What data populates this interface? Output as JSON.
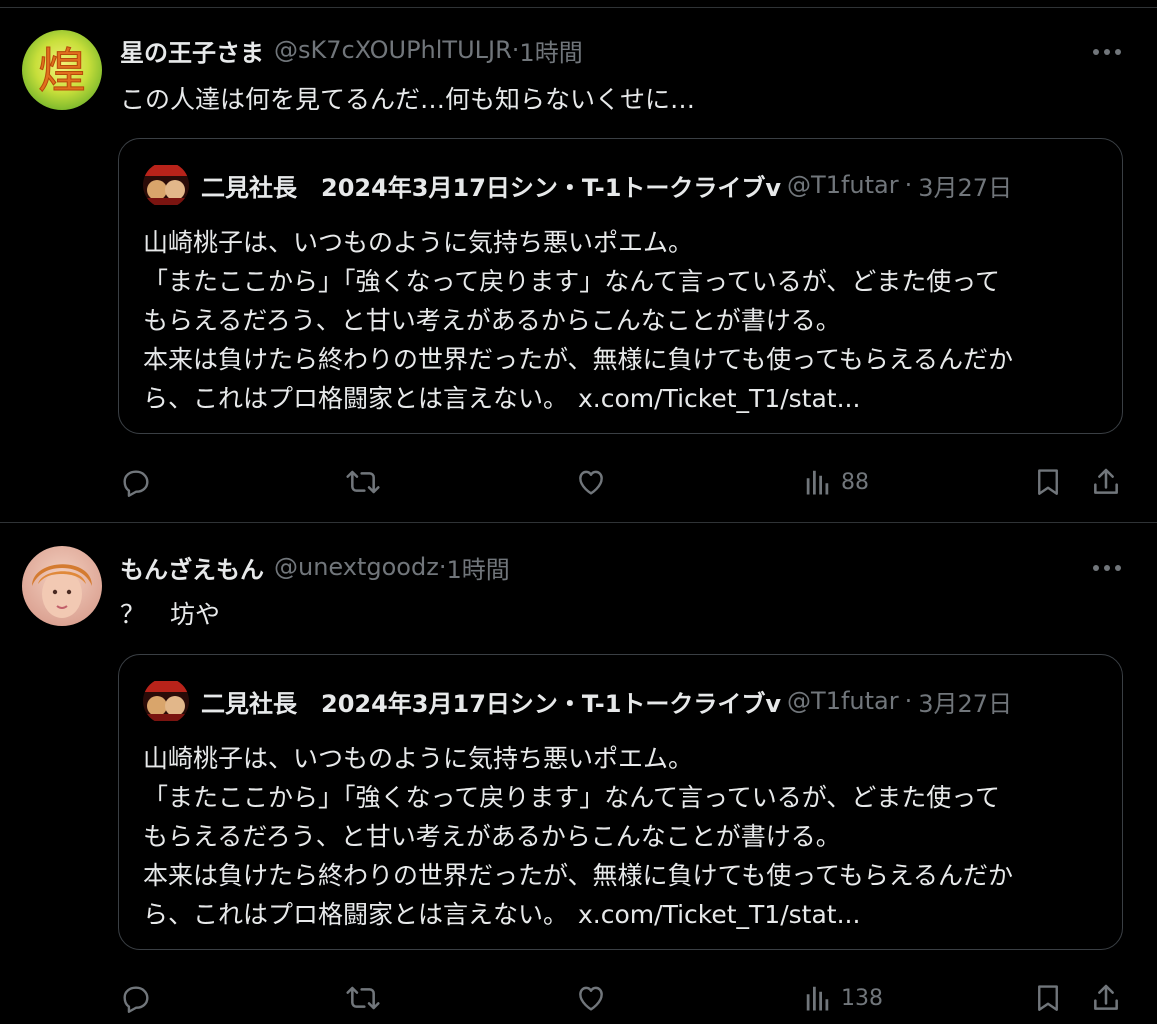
{
  "tweets": [
    {
      "author": {
        "name": "星の王子さま",
        "handle": "@sK7cXOUPhlTULJR",
        "time": "1時間",
        "avatar_glyph": "煌"
      },
      "text": "この人達は何を見てるんだ…何も知らないくせに…",
      "quote": {
        "name": "二見社長　2024年3月17日シン・T-1トークライブv",
        "handle": "@T1futar",
        "time": "3月27日",
        "lines": [
          "山崎桃子は、いつものように気持ち悪いポエム。",
          "「またここから」「強くなって戻ります」なんて言っているが、どまた使って",
          "もらえるだろう、と甘い考えがあるからこんなことが書ける。",
          "本来は負けたら終わりの世界だったが、無様に負けても使ってもらえるんだか",
          "ら、これはプロ格闘家とは言えない。"
        ],
        "link": "x.com/Ticket_T1/stat..."
      },
      "actions": {
        "views": "88"
      }
    },
    {
      "author": {
        "name": "もんざえもん",
        "handle": "@unextgoodz",
        "time": "1時間"
      },
      "text": "？　坊や",
      "quote": {
        "name": "二見社長　2024年3月17日シン・T-1トークライブv",
        "handle": "@T1futar",
        "time": "3月27日",
        "lines": [
          "山崎桃子は、いつものように気持ち悪いポエム。",
          "「またここから」「強くなって戻ります」なんて言っているが、どまた使って",
          "もらえるだろう、と甘い考えがあるからこんなことが書ける。",
          "本来は負けたら終わりの世界だったが、無様に負けても使ってもらえるんだか",
          "ら、これはプロ格闘家とは言えない。"
        ],
        "link": "x.com/Ticket_T1/stat..."
      },
      "actions": {
        "views": "138"
      }
    }
  ],
  "separator": "·",
  "icons": {
    "more": "more-horizontal-icon",
    "reply": "reply-icon",
    "retweet": "retweet-icon",
    "like": "heart-icon",
    "views": "bar-chart-icon",
    "bookmark": "bookmark-icon",
    "share": "share-icon"
  },
  "colors": {
    "background": "#000000",
    "text": "#e7e9ea",
    "secondary": "#71767b",
    "border": "#3a3f44"
  }
}
